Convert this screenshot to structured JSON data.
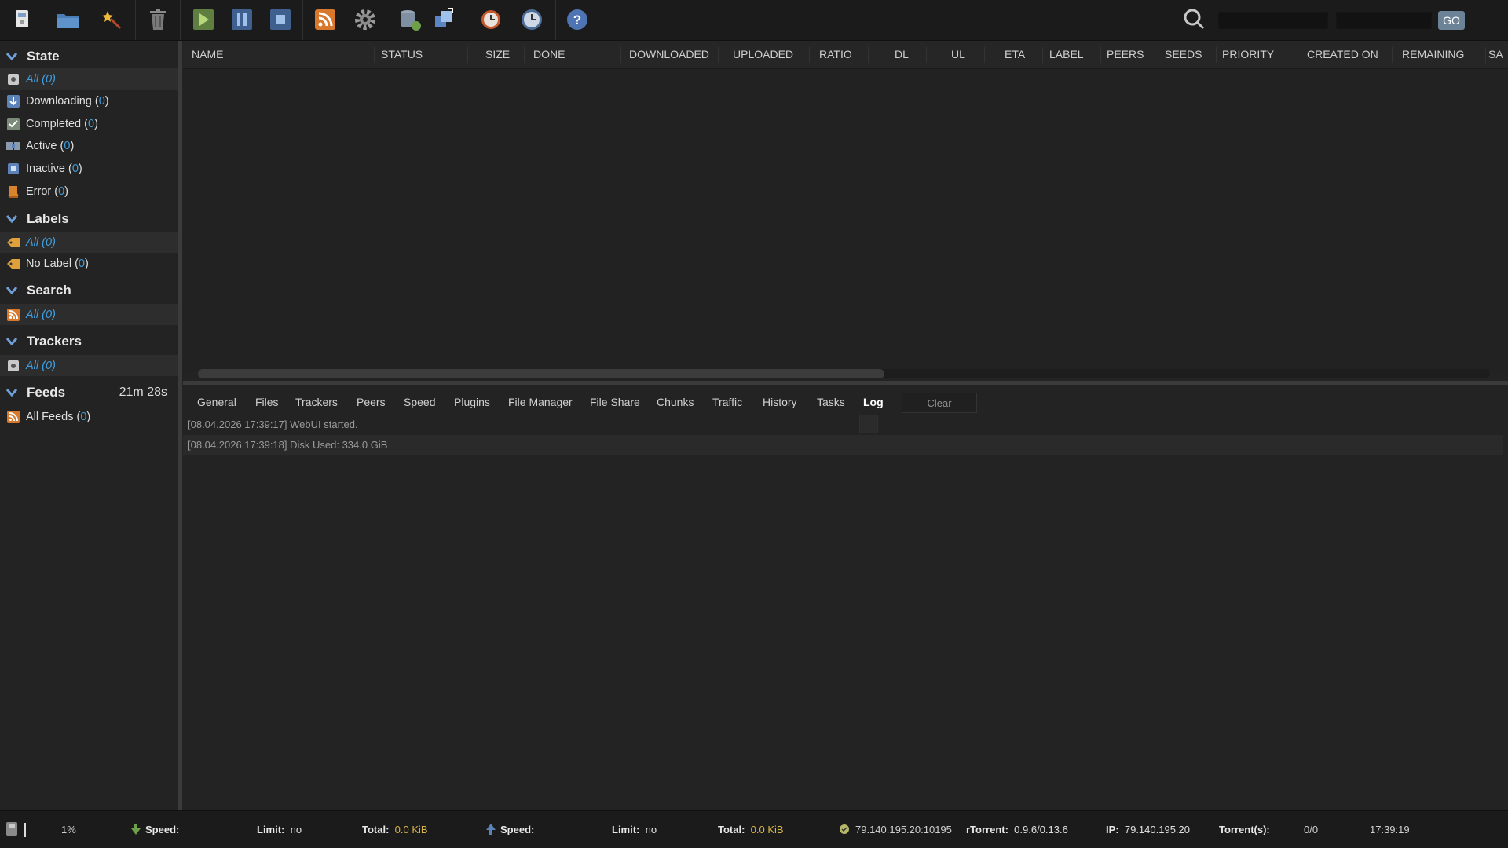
{
  "toolbar": {
    "buttons": [
      {
        "icon": "add-torrent-icon",
        "tooltip": "Add torrent"
      },
      {
        "icon": "folder-icon",
        "tooltip": "Open folder"
      },
      {
        "icon": "magic-wand-icon",
        "tooltip": "Create"
      },
      {
        "icon": "trash-icon",
        "tooltip": "Remove"
      },
      {
        "icon": "play-icon",
        "tooltip": "Start"
      },
      {
        "icon": "pause-icon",
        "tooltip": "Pause"
      },
      {
        "icon": "stop-icon",
        "tooltip": "Stop"
      },
      {
        "icon": "rss-icon",
        "tooltip": "RSS"
      },
      {
        "icon": "gear-icon",
        "tooltip": "Settings"
      },
      {
        "icon": "database-icon",
        "tooltip": "Plugins"
      },
      {
        "icon": "transfer-icon",
        "tooltip": "Transfer"
      },
      {
        "icon": "scheduler-icon",
        "tooltip": "Scheduler"
      },
      {
        "icon": "clock-icon",
        "tooltip": "Timer"
      },
      {
        "icon": "help-icon",
        "tooltip": "Help"
      }
    ],
    "search_value": "",
    "search_engine_value": "",
    "go_label": "GO"
  },
  "sidebar": {
    "state": {
      "title": "State",
      "items": [
        {
          "label": "All",
          "count": "0",
          "icon": "all-icon",
          "selected": true
        },
        {
          "label": "Downloading",
          "count": "0",
          "icon": "downloading-icon"
        },
        {
          "label": "Completed",
          "count": "0",
          "icon": "completed-icon"
        },
        {
          "label": "Active",
          "count": "0",
          "icon": "active-icon"
        },
        {
          "label": "Inactive",
          "count": "0",
          "icon": "inactive-icon"
        },
        {
          "label": "Error",
          "count": "0",
          "icon": "error-icon"
        }
      ]
    },
    "labels": {
      "title": "Labels",
      "items": [
        {
          "label": "All",
          "count": "0",
          "icon": "label-icon",
          "selected": true
        },
        {
          "label": "No Label",
          "count": "0",
          "icon": "label-icon"
        }
      ]
    },
    "search": {
      "title": "Search",
      "items": [
        {
          "label": "All",
          "count": "0",
          "icon": "rss-icon",
          "selected": true
        }
      ]
    },
    "trackers": {
      "title": "Trackers",
      "items": [
        {
          "label": "All",
          "count": "0",
          "icon": "tracker-icon",
          "selected": true
        }
      ]
    },
    "feeds": {
      "title": "Feeds",
      "timer": "21m 28s",
      "items": [
        {
          "label": "All Feeds",
          "count": "0",
          "icon": "rss-icon"
        }
      ]
    }
  },
  "grid": {
    "columns": [
      "NAME",
      "STATUS",
      "SIZE",
      "DONE",
      "DOWNLOADED",
      "UPLOADED",
      "RATIO",
      "DL",
      "UL",
      "ETA",
      "LABEL",
      "PEERS",
      "SEEDS",
      "PRIORITY",
      "CREATED ON",
      "REMAINING",
      "SA"
    ],
    "rows": []
  },
  "details": {
    "tabs": [
      "General",
      "Files",
      "Trackers",
      "Peers",
      "Speed",
      "Plugins",
      "File Manager",
      "File Share",
      "Chunks",
      "Traffic",
      "History",
      "Tasks",
      "Log"
    ],
    "active_tab": "Log",
    "clear_label": "Clear",
    "log": [
      "[08.04.2026 17:39:17] WebUI started.",
      "[08.04.2026 17:39:18] Disk Used: 334.0 GiB"
    ]
  },
  "statusbar": {
    "disk_percent": "1%",
    "download": {
      "speed_label": "Speed:",
      "speed_value": "",
      "limit_label": "Limit:",
      "limit_value": "no",
      "total_label": "Total:",
      "total_value": "0.0 KiB"
    },
    "upload": {
      "speed_label": "Speed:",
      "speed_value": "",
      "limit_label": "Limit:",
      "limit_value": "no",
      "total_label": "Total:",
      "total_value": "0.0 KiB"
    },
    "listen_address": "79.140.195.20:10195",
    "rtorrent_label": "rTorrent:",
    "rtorrent_version": "0.9.6/0.13.6",
    "ip_label": "IP:",
    "ip_value": "79.140.195.20",
    "torrents_label": "Torrent(s):",
    "torrents_value": "0/0",
    "time": "17:39:19"
  },
  "colors": {
    "background": "#232323",
    "toolbar": "#1b1b1b",
    "accent_blue": "#3f9fe0",
    "total_value": "#d8b34a",
    "go_button": "#6c8296"
  }
}
